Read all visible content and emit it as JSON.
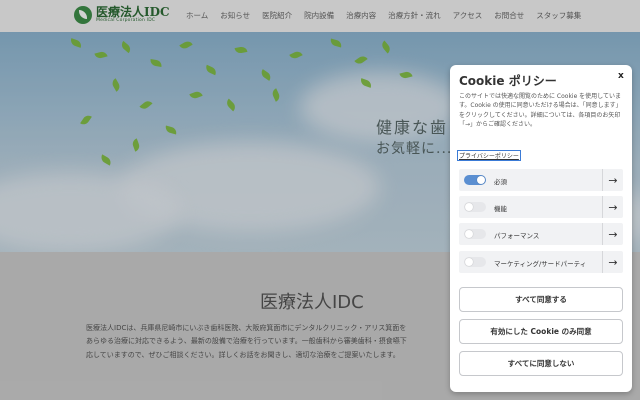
{
  "header": {
    "logo_title": "医療法人IDC",
    "logo_subtitle": "Medical Corporation IDC",
    "nav": [
      "ホーム",
      "お知らせ",
      "医院紹介",
      "院内設備",
      "治療内容",
      "治療方針・流れ",
      "アクセス",
      "お問合せ",
      "スタッフ募集"
    ]
  },
  "hero": {
    "line1": "健康な歯",
    "line2": "お気軽に..."
  },
  "main": {
    "title": "医療法人IDC",
    "lines": [
      "医療法人IDCは、兵庫県尼崎市にいぶき歯科医院、大阪府箕面市にデンタルクリニック・アリス箕面を",
      "あらゆる治療に対応できるよう、最新の設備で治療を行っています。一般歯科から審美歯科・摂食嚥下",
      "応していますので、ぜひご相談ください。詳しくお話をお聞きし、適切な治療をご提案いたします。"
    ]
  },
  "cookie": {
    "title": "Cookie ポリシー",
    "close": "x",
    "description": "このサイトでは快適な閲覧のために Cookie を使用しています。Cookie の使用に同意いただける場合は、「同意します」をクリックしてください。詳細については、各項目のお矢印「→」からご確認ください。",
    "policy_link": "プライバシーポリシー",
    "arrow": "→",
    "categories": [
      {
        "label": "必須",
        "enabled": true
      },
      {
        "label": "機能",
        "enabled": false
      },
      {
        "label": "パフォーマンス",
        "enabled": false
      },
      {
        "label": "マーケティング/サードパーティ",
        "enabled": false
      }
    ],
    "buttons": {
      "accept_all": "すべて同意する",
      "accept_enabled": "有効にした Cookie のみ同意",
      "reject_all": "すべてに同意しない"
    },
    "toggle_on_color": "#5b8fd1"
  }
}
